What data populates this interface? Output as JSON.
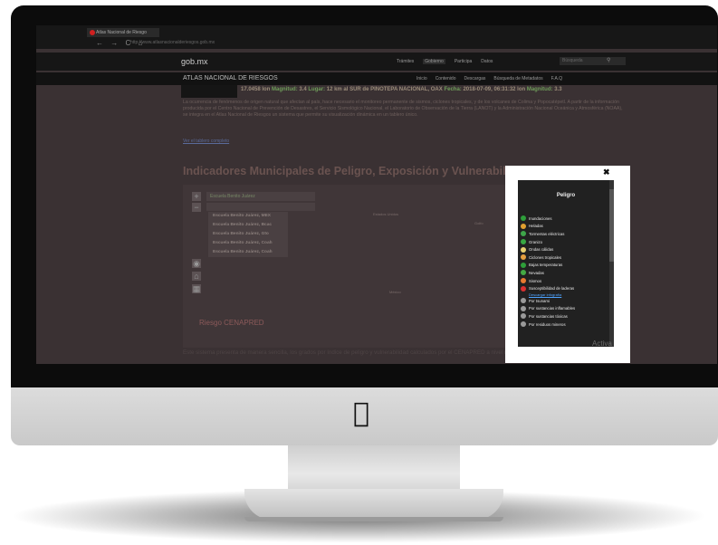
{
  "browser": {
    "tab_title": "Atlas Nacional de Riesgo",
    "nav_icons": "← → C ⌂",
    "url": "http://www.atlasnacionalderiesgos.gob.mx"
  },
  "header": {
    "logo": "gob.mx",
    "nav": [
      "Trámites",
      "Gobierno",
      "Participa",
      "Datos"
    ],
    "search_placeholder": "Búsqueda"
  },
  "atlas": {
    "title": "ATLAS NACIONAL DE RIESGOS",
    "nav": [
      "Inicio",
      "Contenido",
      "Descargas",
      "Búsqueda de Metadatos",
      "F.A.Q"
    ]
  },
  "ticker": {
    "part1": "17.0458 lon",
    "magnitud_label": "Magnitud:",
    "magnitud": "3.4",
    "lugar_label": "Lugar:",
    "lugar": "12 km al SUR de PINOTEPA NACIONAL, OAX",
    "fecha_label": "Fecha:",
    "fecha": "2018-07-09, 06:31:32",
    "part2": "lon",
    "magnitud2": "3.3"
  },
  "intro": {
    "paragraph": "La ocurrencia de fenómenos de origen natural que afectan al país, hace necesario el monitoreo permanente de sismos, ciclones tropicales, y de los volcanes de Colima y Popocatépetl. A partir de la información producida por el Centro Nacional de Prevención de Desastres, el Servicio Sismológico Nacional, el Laboratorio de Observación de la Tierra (LANOT) y la Administración Nacional Oceánica y Atmosférica (NOAA), se integra en el Atlas Nacional de Riesgos un sistema que permite su visualización dinámica en un tablero único.",
    "link": "Ver el tablero completo"
  },
  "section_title": "Indicadores Municipales de Peligro, Exposición y Vulnerabilidad",
  "map": {
    "zoom_in": "+",
    "zoom_out": "−",
    "search_value": "Escuela Benito Juárez",
    "search_sub": "",
    "suggestions": [
      "Escuela Benito Juárez, MEX",
      "Escuela Benito Juárez, Bcac",
      "Escuela Benito Juárez, Gto",
      "Escuela Benito Juárez, Coah",
      "Escuela Benito Juárez, Coah"
    ],
    "label_top": "Estados Unidos",
    "label_right": "Golfo",
    "label_mid": "México",
    "watermark": "Riesgo CENAPRED"
  },
  "popup": {
    "close": "✖",
    "title": "Peligro",
    "items": [
      {
        "label": "Inundaciones",
        "color": "#2e9e3a"
      },
      {
        "label": "Heladas",
        "color": "#e0a030"
      },
      {
        "label": "Tormentas eléctricas",
        "color": "#3ea54a"
      },
      {
        "label": "Granizo",
        "color": "#38a842"
      },
      {
        "label": "Ondas cálidas",
        "color": "#e8d070"
      },
      {
        "label": "Ciclones tropicales",
        "color": "#e6a040"
      },
      {
        "label": "Bajas temperaturas",
        "color": "#2e9e3a"
      },
      {
        "label": "Nevadas",
        "color": "#44aa44"
      },
      {
        "label": "Sismos",
        "color": "#e77a30"
      },
      {
        "label": "Susceptibilidad de laderas",
        "color": "#d93030"
      }
    ],
    "download_link": "Descargar infografía",
    "items_grey": [
      {
        "label": "Por tsunami",
        "color": "#9a9a9a"
      },
      {
        "label": "Por sustancias inflamables",
        "color": "#9a9a9a"
      },
      {
        "label": "Por sustancias tóxicas",
        "color": "#9a9a9a"
      },
      {
        "label": "Por residuos mineros",
        "color": "#9a9a9a"
      }
    ]
  },
  "footer_text": "Este sistema presenta de manera sencilla, los grados por índice de peligro y vulnerabilidad calculados por el CENAPRED a nivel municipal.",
  "windows_watermark": "Activa"
}
